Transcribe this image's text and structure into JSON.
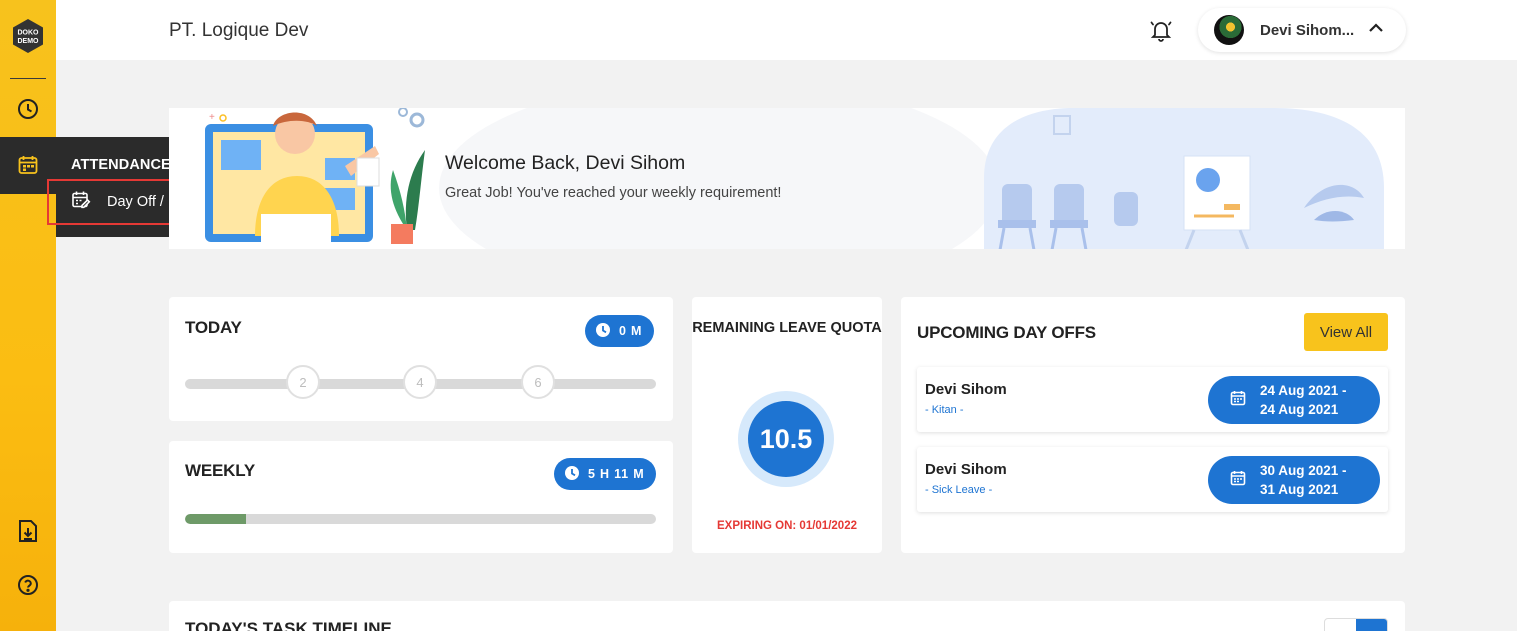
{
  "header": {
    "company": "PT. Logique Dev",
    "user_name": "Devi Sihom..."
  },
  "sidebar": {
    "logo_text": "DOKO DEMO",
    "icons": [
      "clock-icon",
      "calendar-icon",
      "download-doc-icon",
      "help-icon"
    ]
  },
  "flyout": {
    "title": "ATTENDANCE",
    "items": [
      {
        "label": "Day Off / Leave"
      }
    ]
  },
  "banner": {
    "title": "Welcome Back, Devi Sihom",
    "subtitle": "Great Job! You've reached your weekly requirement!"
  },
  "today": {
    "title": "TODAY",
    "duration": "0 M",
    "ticks": [
      "2",
      "4",
      "6"
    ]
  },
  "weekly": {
    "title": "WEEKLY",
    "duration": "5 H 11 M",
    "progress": 0.13
  },
  "quota": {
    "title": "REMAINING LEAVE QUOTA",
    "value": "10.5",
    "expiry": "EXPIRING ON: 01/01/2022"
  },
  "upcoming": {
    "title": "UPCOMING DAY OFFS",
    "view_all": "View All",
    "items": [
      {
        "name": "Devi Sihom",
        "type": "- Kitan -",
        "start": "24 Aug 2021 -",
        "end": "24 Aug 2021"
      },
      {
        "name": "Devi Sihom",
        "type": "- Sick Leave -",
        "start": "30 Aug 2021 -",
        "end": "31 Aug 2021"
      }
    ]
  },
  "timeline": {
    "title": "TODAY'S TASK TIMELINE"
  },
  "colors": {
    "accent": "#1e74d2",
    "sidebar": "#f7c21d",
    "danger": "#e53935",
    "progress": "#6e9a68"
  }
}
